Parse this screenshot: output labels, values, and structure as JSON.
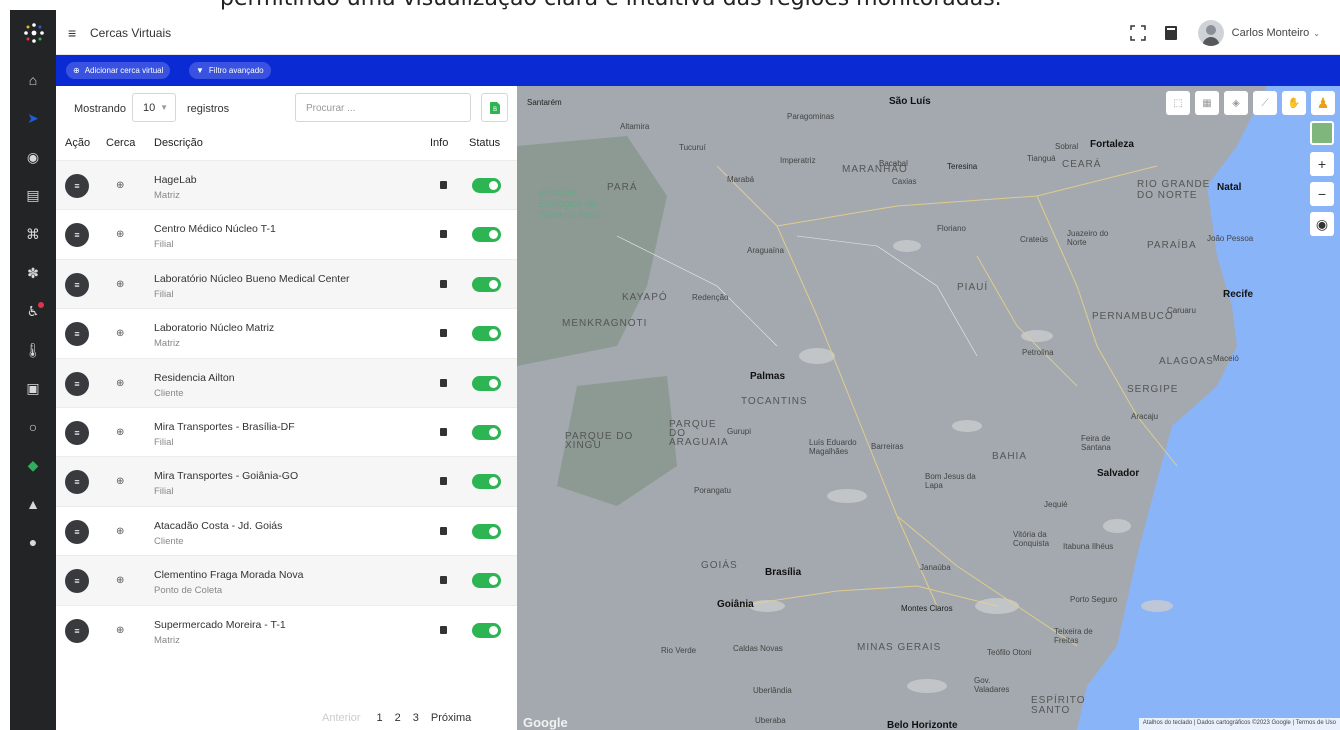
{
  "caption": {
    "text": "permitindo uma visualização clara e intuitiva das regiões monitoradas."
  },
  "header": {
    "title": "Cercas Virtuais",
    "user_name": "Carlos Monteiro"
  },
  "actions": {
    "add_label": "Adicionar cerca virtual",
    "filter_label": "Filtro avançado"
  },
  "controls": {
    "show_label": "Mostrando",
    "page_size": "10",
    "records_label": "registros",
    "search_placeholder": "Procurar ..."
  },
  "table": {
    "columns": {
      "action": "Ação",
      "fence": "Cerca",
      "description": "Descrição",
      "info": "Info",
      "status": "Status"
    },
    "rows": [
      {
        "name": "HageLab",
        "type": "Matriz",
        "active": true
      },
      {
        "name": "Centro Médico Núcleo T-1",
        "type": "Filial",
        "active": true
      },
      {
        "name": "Laboratório Núcleo Bueno Medical Center",
        "type": "Filial",
        "active": true
      },
      {
        "name": "Laboratorio Núcleo Matriz",
        "type": "Matriz",
        "active": true
      },
      {
        "name": "Residencia Ailton",
        "type": "Cliente",
        "active": true
      },
      {
        "name": "Mira Transportes - Brasília-DF",
        "type": "Filial",
        "active": true
      },
      {
        "name": "Mira Transportes - Goiânia-GO",
        "type": "Filial",
        "active": true
      },
      {
        "name": "Atacadão Costa - Jd. Goiás",
        "type": "Cliente",
        "active": true
      },
      {
        "name": "Clementino Fraga Morada Nova",
        "type": "Ponto de Coleta",
        "active": true
      },
      {
        "name": "Supermercado Moreira - T-1",
        "type": "Matriz",
        "active": true
      }
    ]
  },
  "pagination": {
    "previous": "Anterior",
    "pages": [
      "1",
      "2",
      "3"
    ],
    "next": "Próxima"
  },
  "map": {
    "google_logo": "Google",
    "attribution": "Atalhos do teclado  |  Dados cartográficos ©2023 Google  |  Termos de Uso",
    "labels": {
      "santarem": "Santarém",
      "sao_luis": "São Luís",
      "fortaleza": "Fortaleza",
      "maranhao": "MARANHÃO",
      "ceara": "CEARÁ",
      "rio_grande_do_norte": "RIO GRANDE DO NORTE",
      "natal": "Natal",
      "para": "PARÁ",
      "estacao": "Estação Ecológica da Terra do Meio",
      "teresina": "Teresina",
      "piaui": "PIAUÍ",
      "paraiba": "PARAÍBA",
      "joao_pessoa": "João Pessoa",
      "recife": "Recife",
      "pernambuco": "PERNAMBUCO",
      "alagoas": "ALAGOAS",
      "maceio": "Maceió",
      "sergipe": "SERGIPE",
      "aracaju": "Aracaju",
      "tocantins": "TOCANTINS",
      "palmas": "Palmas",
      "bahia": "BAHIA",
      "salvador": "Salvador",
      "goias": "GOIÁS",
      "brasilia": "Brasília",
      "goiania": "Goiânia",
      "minas_gerais": "MINAS GERAIS",
      "espirito_santo": "ESPÍRITO SANTO",
      "belo_horizonte": "Belo Horizonte",
      "imperatriz": "Imperatriz",
      "maraba": "Marabá",
      "araguaina": "Araguaína",
      "caxias": "Caxias",
      "floriano": "Floriano",
      "petrolina": "Petrolina",
      "feira": "Feira de Santana",
      "montes_claros": "Montes Claros",
      "uberlandia": "Uberlândia",
      "porto_seguro": "Porto Seguro",
      "teixeira": "Teixeira de Freitas",
      "ilheus": "Itabuna Ilhéus",
      "vitoria_conquista": "Vitória da Conquista",
      "juazeiro": "Juazeiro do Norte",
      "caruaru": "Caruaru",
      "crateus": "Crateús",
      "sobral": "Sobral",
      "bacabal": "Bacabal",
      "altamira": "Altamira",
      "redencao": "Redenção",
      "gurupi": "Gurupi",
      "porangatu": "Porangatu",
      "barreiras": "Barreiras",
      "luis_eduardo": "Luís Eduardo Magalhães",
      "bom_jesus": "Bom Jesus da Lapa",
      "rio_verde": "Rio Verde",
      "caldas_novas": "Caldas Novas",
      "uberaba": "Uberaba",
      "gov_valadares": "Gov. Valadares",
      "teofilo_otoni": "Teófilo Otoni",
      "janauba": "Janaúba",
      "jequie": "Jequié",
      "paragominas": "Paragominas",
      "tucurui": "Tucuruí",
      "xingu": "PARQUE DO XINGU",
      "kayapo": "KAYAPÓ",
      "menkragnoti": "MENKRAGNOTI",
      "araguaia": "PARQUE DO ARAGUAIA",
      "tianguá": "Tianguá"
    }
  }
}
